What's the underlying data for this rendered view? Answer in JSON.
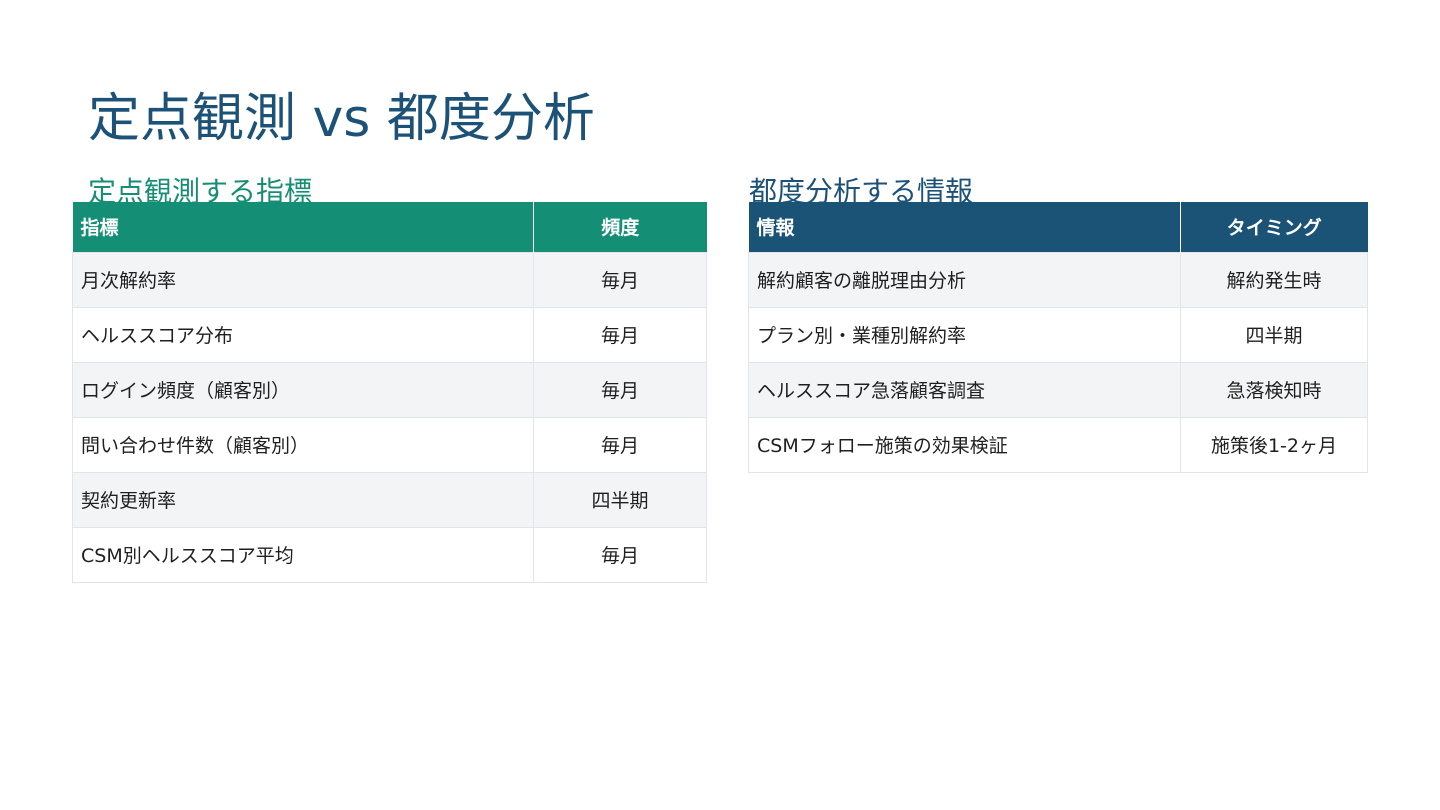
{
  "slide": {
    "title": "定点観測 vs 都度分析"
  },
  "left_section": {
    "heading": "定点観測する指標",
    "header_main": "指標",
    "header_sub": "頻度",
    "rows": [
      {
        "main": "月次解約率",
        "sub": "毎月"
      },
      {
        "main": "ヘルススコア分布",
        "sub": "毎月"
      },
      {
        "main": "ログイン頻度（顧客別）",
        "sub": "毎月"
      },
      {
        "main": "問い合わせ件数（顧客別）",
        "sub": "毎月"
      },
      {
        "main": "契約更新率",
        "sub": "四半期"
      },
      {
        "main": "CSM別ヘルススコア平均",
        "sub": "毎月"
      }
    ]
  },
  "right_section": {
    "heading": "都度分析する情報",
    "header_main": "情報",
    "header_sub": "タイミング",
    "rows": [
      {
        "main": "解約顧客の離脱理由分析",
        "sub": "解約発生時"
      },
      {
        "main": "プラン別・業種別解約率",
        "sub": "四半期"
      },
      {
        "main": "ヘルススコア急落顧客調査",
        "sub": "急落検知時"
      },
      {
        "main": "CSMフォロー施策の効果検証",
        "sub": "施策後1-2ヶ月"
      }
    ]
  },
  "colors": {
    "title": "#1d5278",
    "left_accent": "#158e76",
    "right_accent": "#1b5376",
    "row_stripe": "#f3f4f6"
  }
}
